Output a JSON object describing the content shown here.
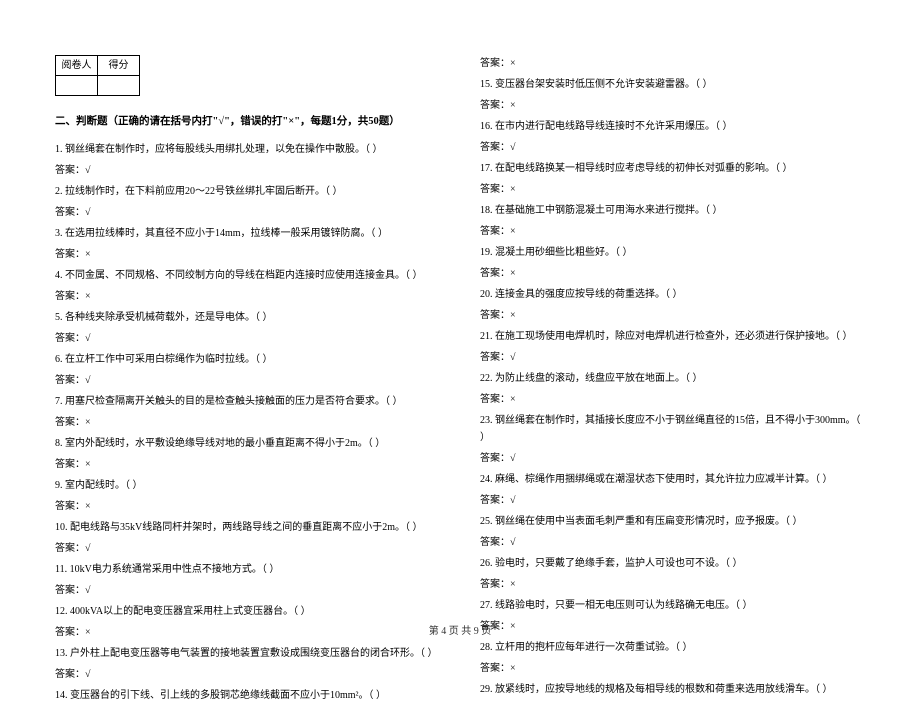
{
  "score_table": {
    "header_grader": "阅卷人",
    "header_score": "得分"
  },
  "section": {
    "title": "二、判断题（正确的请在括号内打\"√\"，错误的打\"×\"，每题1分，共50题）"
  },
  "left_items": [
    {
      "q": "1. 钢丝绳套在制作时，应将每股线头用绑扎处理，以免在操作中散股。（    ）",
      "a": "答案：√"
    },
    {
      "q": "2. 拉线制作时，在下料前应用20～22号铁丝绑扎牢固后断开。（    ）",
      "a": "答案：√"
    },
    {
      "q": "3. 在选用拉线棒时，其直径不应小于14mm，拉线棒一般采用镀锌防腐。（    ）",
      "a": "答案：×"
    },
    {
      "q": "4. 不同金属、不同规格、不同绞制方向的导线在档距内连接时应使用连接金具。（    ）",
      "a": "答案：×"
    },
    {
      "q": "5. 各种线夹除承受机械荷载外，还是导电体。（    ）",
      "a": "答案：√"
    },
    {
      "q": "6. 在立杆工作中可采用白棕绳作为临时拉线。（    ）",
      "a": "答案：√"
    },
    {
      "q": "7. 用塞尺检查隔离开关触头的目的是检查触头接触面的压力是否符合要求。（    ）",
      "a": "答案：×"
    },
    {
      "q": "8. 室内外配线时，水平敷设绝缘导线对地的最小垂直距离不得小于2m。（    ）",
      "a": "答案：×"
    },
    {
      "q": "9. 室内配线时。（   ）",
      "a": "答案：×"
    },
    {
      "q": "10. 配电线路与35kV线路同杆并架时，两线路导线之间的垂直距离不应小于2m。（    ）",
      "a": "答案：√"
    },
    {
      "q": "11. 10kV电力系统通常采用中性点不接地方式。（    ）",
      "a": "答案：√"
    },
    {
      "q": "12. 400kVA以上的配电变压器宜采用柱上式变压器台。（    ）",
      "a": "答案：×"
    },
    {
      "q": "13. 户外柱上配电变压器等电气装置的接地装置宜敷设成围绕变压器台的闭合环形。（  ）",
      "a": "答案：√"
    },
    {
      "q": "14. 变压器台的引下线、引上线的多股铜芯绝缘线截面不应小于10mm²。（    ）",
      "a": ""
    }
  ],
  "right_items": [
    {
      "q": "",
      "a": "答案：×"
    },
    {
      "q": "15. 变压器台架安装时低压侧不允许安装避雷器。（    ）",
      "a": "答案：×"
    },
    {
      "q": "16. 在市内进行配电线路导线连接时不允许采用爆压。（    ）",
      "a": "答案：√"
    },
    {
      "q": "17. 在配电线路换某一相导线时应考虑导线的初伸长对弧垂的影响。（    ）",
      "a": "答案：×"
    },
    {
      "q": "18. 在基础施工中钢筋混凝土可用海水来进行搅拌。（    ）",
      "a": "答案：×"
    },
    {
      "q": "19. 混凝土用砂细些比粗些好。（    ）",
      "a": "答案：×"
    },
    {
      "q": "20. 连接金具的强度应按导线的荷重选择。（    ）",
      "a": "答案：×"
    },
    {
      "q": "21. 在施工现场使用电焊机时，除应对电焊机进行检查外，还必须进行保护接地。（  ）",
      "a": "答案：√"
    },
    {
      "q": "22. 为防止线盘的滚动，线盘应平放在地面上。（    ）",
      "a": "答案：×"
    },
    {
      "q": "23. 钢丝绳套在制作时，其插接长度应不小于钢丝绳直径的15倍，且不得小于300mm。（   ）",
      "a": "答案：√"
    },
    {
      "q": "24. 麻绳、棕绳作用捆绑绳或在潮湿状态下使用时，其允许拉力应减半计算。（    ）",
      "a": "答案：√"
    },
    {
      "q": "25. 钢丝绳在使用中当表面毛刺严重和有压扁变形情况时，应予报废。（    ）",
      "a": "答案：√"
    },
    {
      "q": "26. 验电时，只要戴了绝缘手套，监护人可设也可不设。（    ）",
      "a": "答案：×"
    },
    {
      "q": "27. 线路验电时，只要一相无电压则可认为线路确无电压。（    ）",
      "a": "答案：×"
    },
    {
      "q": "28. 立杆用的抱杆应每年进行一次荷重试验。（    ）",
      "a": "答案：×"
    },
    {
      "q": "29. 放紧线时，应按导地线的规格及每相导线的根数和荷重来选用放线滑车。（    ）",
      "a": ""
    }
  ],
  "page_number": "第  4  页    共  9  页"
}
